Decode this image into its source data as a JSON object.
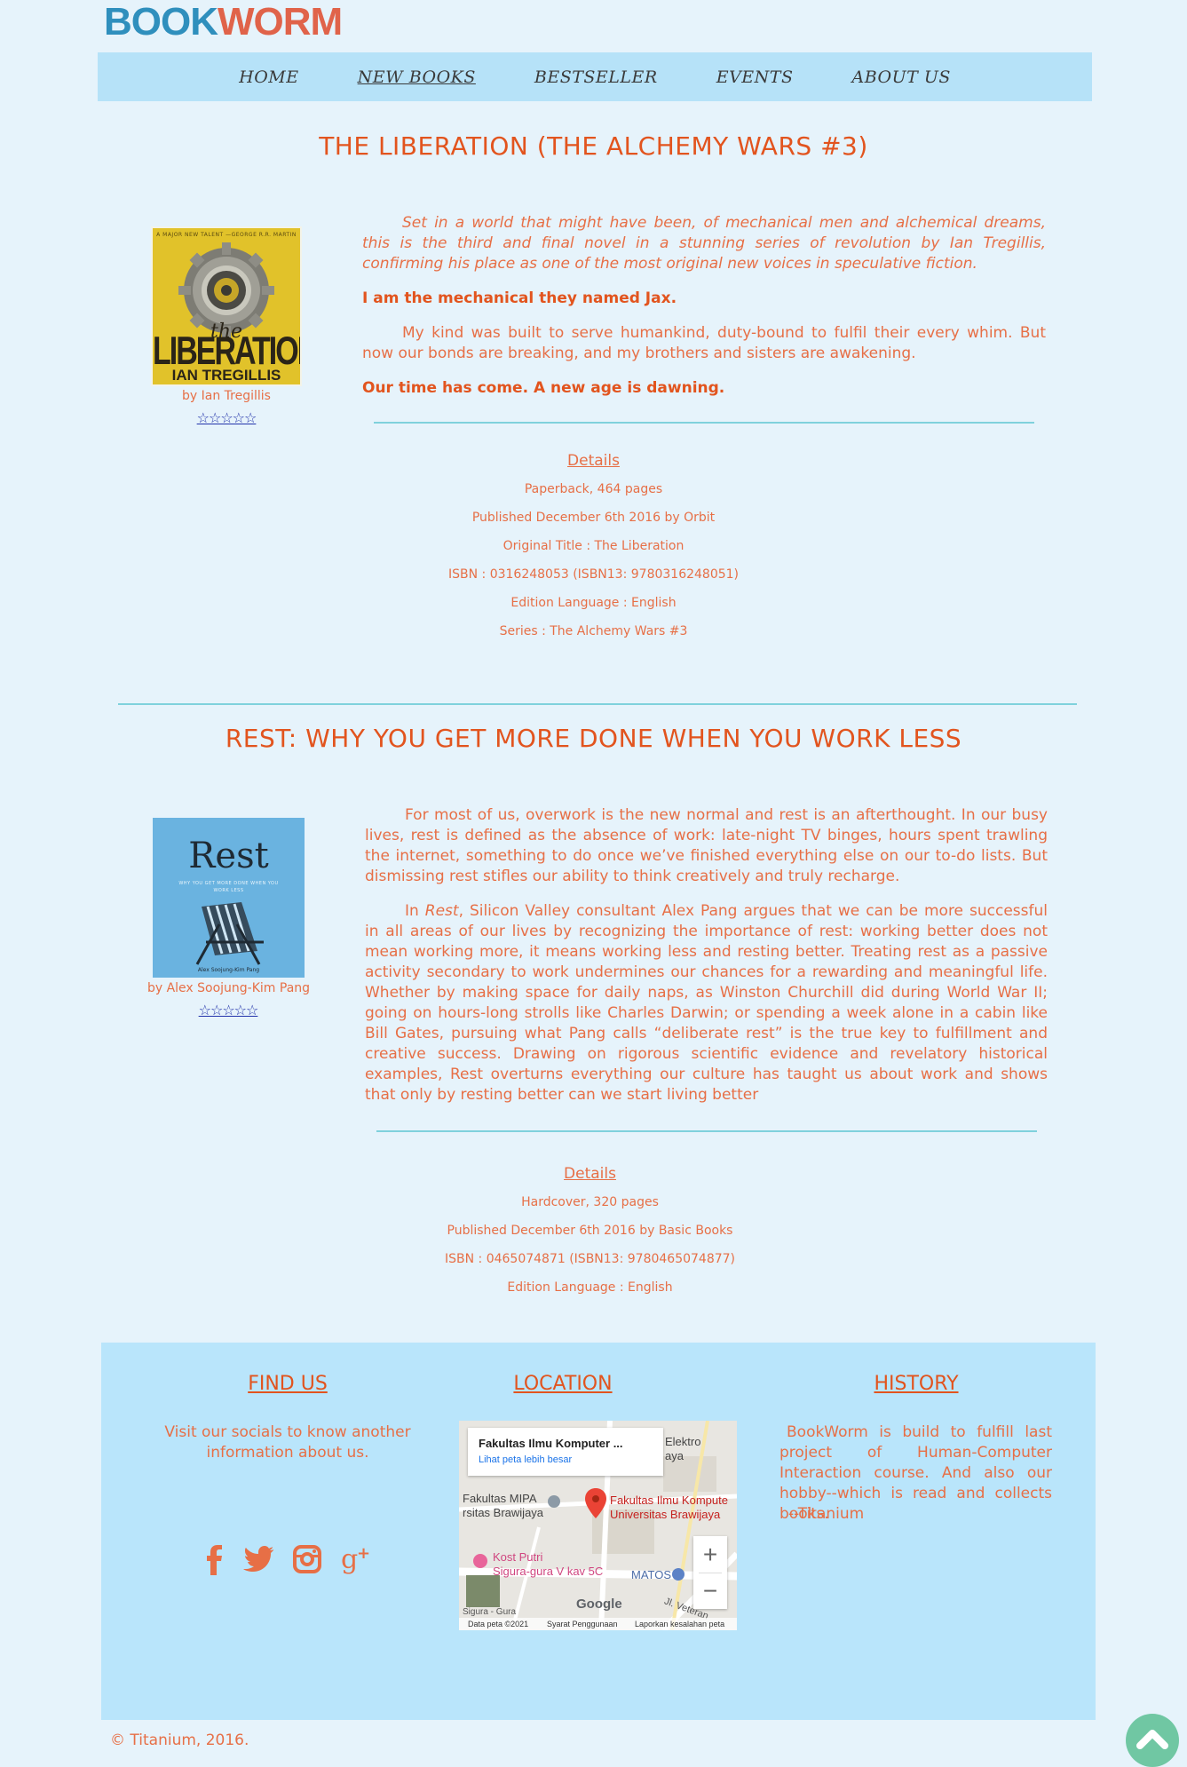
{
  "logo": {
    "part1": "BOOK",
    "part2": "WORM"
  },
  "nav": {
    "items": [
      {
        "label": "HOME",
        "active": false
      },
      {
        "label": "NEW BOOKS",
        "active": true
      },
      {
        "label": "BESTSELLER",
        "active": false
      },
      {
        "label": "EVENTS",
        "active": false
      },
      {
        "label": "ABOUT US",
        "active": false
      }
    ]
  },
  "book1": {
    "title": "THE LIBERATION (THE ALCHEMY WARS #3)",
    "cover_top": "A MAJOR NEW TALENT —GEORGE R.R. MARTIN",
    "cover_the": "the",
    "cover_title": "LIBERATION",
    "cover_author": "IAN TREGILLIS",
    "author": "by Ian Tregillis",
    "stars": "☆☆☆☆☆",
    "para1": "Set in a world that might have been, of mechanical men and alchemical dreams, this is the third and final novel in a stunning series of revolution by Ian Tregillis, confirming his place as one of the most original new voices in speculative fiction.",
    "para2": "I am the mechanical they named Jax.",
    "para3": "My kind was built to serve humankind, duty-bound to fulfil their every whim. But now our bonds are breaking, and my brothers and sisters are awakening.",
    "para4": "Our time has come. A new age is dawning.",
    "details_head": "Details",
    "details": [
      "Paperback, 464 pages",
      "Published December 6th 2016 by Orbit",
      "Original Title : The Liberation",
      "ISBN : 0316248053 (ISBN13: 9780316248051)",
      "Edition Language : English",
      "Series : The Alchemy Wars #3"
    ]
  },
  "book2": {
    "title": "REST: WHY YOU GET MORE DONE WHEN YOU WORK LESS",
    "cover_title": "Rest",
    "cover_sub": "WHY YOU GET MORE DONE WHEN YOU WORK LESS",
    "cover_author": "Alex Soojung-Kim Pang",
    "author": "by Alex Soojung-Kim Pang",
    "stars": "☆☆☆☆☆",
    "para1": "For most of us, overwork is the new normal and rest is an afterthought. In our busy lives, rest is defined as the absence of work: late-night TV binges, hours spent trawling the internet, something to do once we’ve finished everything else on our to-do lists. But dismissing rest stifles our ability to think creatively and truly recharge.",
    "para2_prefix": "In ",
    "para2_em": "Rest",
    "para2_rest": ", Silicon Valley consultant Alex Pang argues that we can be more successful in all areas of our lives by recognizing the importance of rest: working better does not mean working more, it means working less and resting better. Treating rest as a passive activity secondary to work undermines our chances for a rewarding and meaningful life. Whether by making space for daily naps, as Winston Churchill did during World War II; going on hours-long strolls like Charles Darwin; or spending a week alone in a cabin like Bill Gates, pursuing what Pang calls “deliberate rest” is the true key to fulfillment and creative success. Drawing on rigorous scientific evidence and revelatory historical examples, Rest overturns everything our culture has taught us about work and shows that only by resting better can we start living better",
    "details_head": "Details",
    "details": [
      "Hardcover, 320 pages",
      "Published December 6th 2016 by Basic Books",
      "ISBN : 0465074871 (ISBN13: 9780465074877)",
      "Edition Language : English"
    ]
  },
  "footer": {
    "find_us_title": "FIND US",
    "find_us_text": "Visit our socials to know another information about us.",
    "location_title": "LOCATION",
    "history_title": "HISTORY",
    "history_text": "BookWorm is build to fulfill last project of Human-Computer Interaction course. And also our hobby--which is read and collects books.",
    "history_sign": "--Titanium",
    "socials": [
      "facebook-icon",
      "twitter-icon",
      "instagram-icon",
      "google-plus-icon"
    ],
    "map": {
      "card_title": "Fakultas Ilmu Komputer ...",
      "card_link": "Lihat peta lebih besar",
      "label_elektro": "Elektro",
      "label_elektro2": "aya",
      "label_mipa1": "Fakultas MIPA",
      "label_mipa2": "rsitas Brawijaya",
      "label_pin1": "Fakultas Ilmu Kompute",
      "label_pin2": "Universitas Brawijaya",
      "label_kost1": "Kost Putri",
      "label_kost2": "Sigura-gura V kav 5C",
      "label_matos": "MATOS",
      "label_veteran": "Jl. Veteran",
      "label_sigura": "Sigura - Gura",
      "google": "Google",
      "attr1": "Data peta ©2021",
      "attr2": "Syarat Penggunaan",
      "attr3": "Laporkan kesalahan peta",
      "zoom_in": "+",
      "zoom_out": "−"
    }
  },
  "copyright": "© Titanium, 2016.",
  "colors": {
    "accent": "#e2541e",
    "text": "#e76f46",
    "nav_bg": "#b6e2f8",
    "page_bg": "#e6f3fb",
    "divider": "#7fd1dc",
    "top_button": "#70c7a3"
  }
}
